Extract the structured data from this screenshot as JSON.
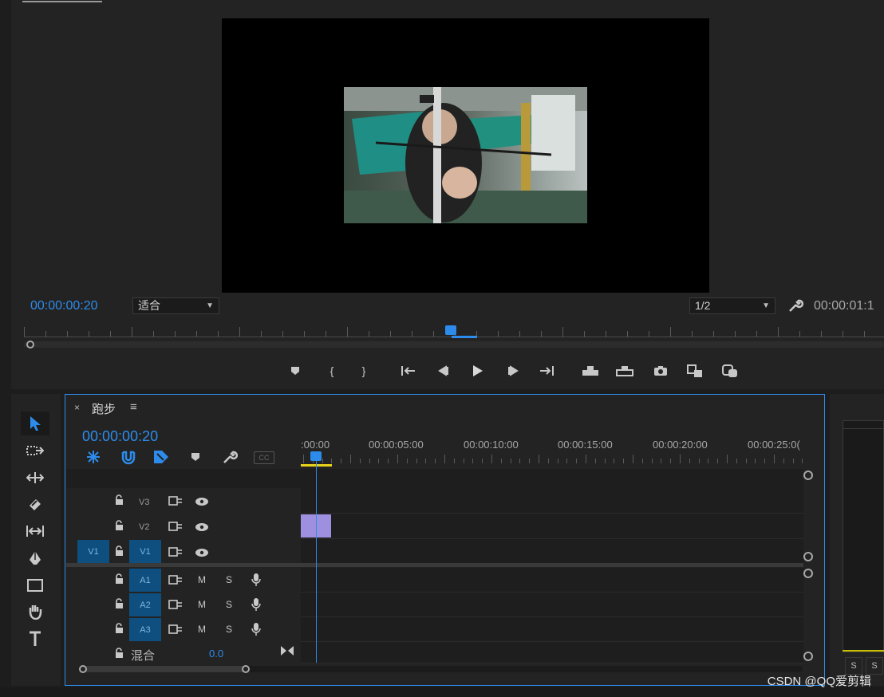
{
  "monitor": {
    "current_timecode": "00:00:00:20",
    "fit_label": "适合",
    "resolution_label": "1/2",
    "duration_timecode": "00:00:01:1"
  },
  "timeline": {
    "close_label": "×",
    "sequence_name": "跑步",
    "menu_label": "≡",
    "timecode": "00:00:00:20",
    "ruler_labels": [
      ":00:00",
      "00:00:05:00",
      "00:00:10:00",
      "00:00:15:00",
      "00:00:20:00",
      "00:00:25:0("
    ],
    "video_tracks": [
      {
        "name": "V3",
        "source": ""
      },
      {
        "name": "V2",
        "source": ""
      },
      {
        "name": "V1",
        "source": "V1"
      }
    ],
    "audio_tracks": [
      {
        "name": "A1",
        "mute": "M",
        "solo": "S"
      },
      {
        "name": "A2",
        "mute": "M",
        "solo": "S"
      },
      {
        "name": "A3",
        "mute": "M",
        "solo": "S"
      }
    ],
    "mix_label": "混合",
    "mix_value": "0.0",
    "clip_color": "#9f8fdf",
    "accent": "#2d8ceb"
  },
  "right_panel": {
    "solo_labels": [
      "S",
      "S"
    ]
  },
  "watermark": "CSDN @QQ爱剪辑"
}
